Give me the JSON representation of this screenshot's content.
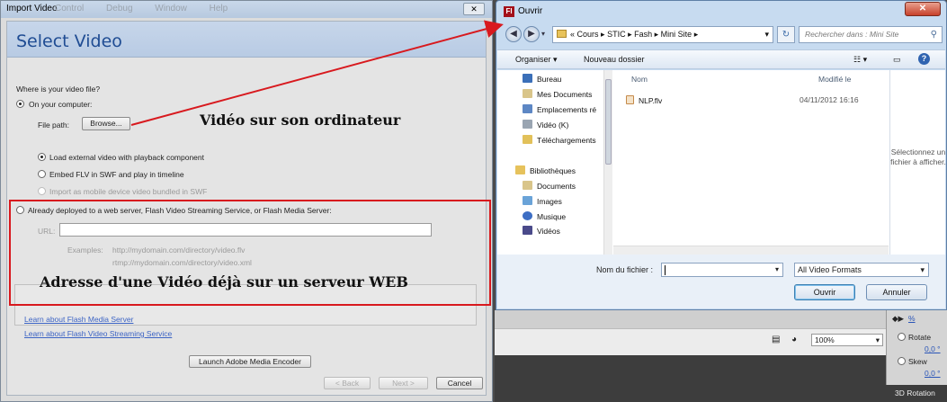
{
  "background_app": {
    "menu": [
      "Control",
      "Debug",
      "Window",
      "Help"
    ],
    "zoom": "100%",
    "right_panel": {
      "rotate_label": "Rotate",
      "rotate_value": "0,0 °",
      "skew_label": "Skew",
      "skew_value": "0,0 °",
      "percent": "%",
      "tab": "3D Rotation"
    }
  },
  "import_video": {
    "window_title": "Import Video",
    "close_glyph": "✕",
    "header_title": "Select Video",
    "question": "Where is your video file?",
    "on_computer_label": "On your computer:",
    "file_path_label": "File path:",
    "browse_label": "Browse...",
    "options": [
      "Load external video with playback component",
      "Embed FLV in SWF and play in timeline",
      "Import as mobile device video bundled in SWF"
    ],
    "web_server_label": "Already deployed to a web server, Flash Video Streaming Service, or Flash Media Server:",
    "url_label": "URL:",
    "url_value": "",
    "examples_label": "Examples:",
    "example_1": "http://mydomain.com/directory/video.flv",
    "example_2": "rtmp://mydomain.com/directory/video.xml",
    "link_fms": "Learn about Flash Media Server",
    "link_fvss": "Learn about Flash Video Streaming Service",
    "launch_encoder": "Launch Adobe Media Encoder",
    "back_label": "< Back",
    "next_label": "Next >",
    "cancel_label": "Cancel"
  },
  "annotations": {
    "local": "Vidéo sur son ordinateur",
    "web": "Adresse d'une Vidéo déjà sur un serveur WEB",
    "arrow_color": "#d8191e",
    "box_color": "#d8191e"
  },
  "ouvrir": {
    "window_title": "Ouvrir",
    "app_icon": "Fl",
    "close_glyph": "✕",
    "address_prefix": "«",
    "breadcrumb": [
      "Cours",
      "STIC",
      "Fash",
      "Mini Site"
    ],
    "search_placeholder": "Rechercher dans : Mini Site",
    "organize_label": "Organiser ▾",
    "new_folder_label": "Nouveau dossier",
    "nav_items": [
      {
        "label": "Bureau",
        "icon": "desktop-icon"
      },
      {
        "label": "Mes Documents",
        "icon": "documents-icon"
      },
      {
        "label": "Emplacements ré",
        "icon": "places-icon"
      },
      {
        "label": "Vidéo (K)",
        "icon": "drive-icon"
      },
      {
        "label": "Téléchargements",
        "icon": "download-icon"
      },
      {
        "label": "Bibliothèques",
        "icon": "libraries-icon"
      },
      {
        "label": "Documents",
        "icon": "documents-icon"
      },
      {
        "label": "Images",
        "icon": "images-icon"
      },
      {
        "label": "Musique",
        "icon": "music-icon"
      },
      {
        "label": "Vidéos",
        "icon": "videos-icon"
      }
    ],
    "col_name": "Nom",
    "col_modified": "Modifié le",
    "files": [
      {
        "name": "NLP.flv",
        "modified": "04/11/2012 16:16"
      }
    ],
    "preview_text": "Sélectionnez un fichier à afficher.",
    "filename_label": "Nom du fichier :",
    "filename_value": "",
    "filetype_value": "All Video Formats",
    "open_label": "Ouvrir",
    "cancel_label": "Annuler"
  }
}
